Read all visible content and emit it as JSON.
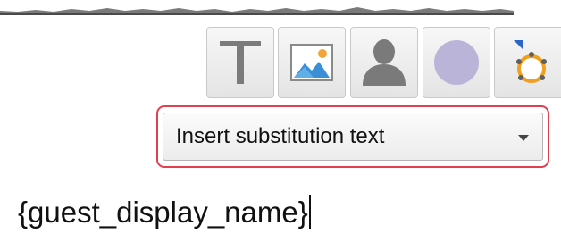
{
  "toolbar": {
    "buttons": [
      {
        "icon": "text-T-icon"
      },
      {
        "icon": "image-icon"
      },
      {
        "icon": "user-silhouette-icon"
      },
      {
        "icon": "circle-icon"
      },
      {
        "icon": "shape-gear-icon"
      }
    ]
  },
  "dropdown": {
    "selected": "Insert substitution text",
    "highlight_color": "#e04050"
  },
  "editor": {
    "content": "{guest_display_name}"
  },
  "colors": {
    "circle_fill": "#b9b4d8",
    "user_fill": "#7a7a7a",
    "image_blue": "#3a8fd6",
    "image_sun": "#f2a33a",
    "gear_orange": "#f0a020",
    "gear_blue_triangle": "#2a66c8"
  }
}
